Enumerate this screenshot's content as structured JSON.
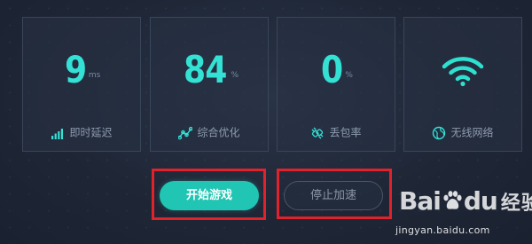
{
  "stats": [
    {
      "value": "9",
      "unit": "ms",
      "label": "即时延迟",
      "icon": "signal-bars-icon"
    },
    {
      "value": "84",
      "unit": "%",
      "label": "综合优化",
      "icon": "trend-line-icon"
    },
    {
      "value": "0",
      "unit": "%",
      "label": "丢包率",
      "icon": "broken-link-icon"
    },
    {
      "label": "无线网络",
      "icon": "globe-icon",
      "status_icon": "wifi-icon"
    }
  ],
  "buttons": {
    "start": "开始游戏",
    "stop": "停止加速"
  },
  "watermark": {
    "logo_text": "Bai",
    "logo_text_2": "du",
    "logo_cn": "经验",
    "url": "jingyan.baidu.com"
  },
  "colors": {
    "accent": "#33e2d4",
    "button": "#20c5b3",
    "highlight": "#e0222b",
    "background": "#1f2737"
  }
}
